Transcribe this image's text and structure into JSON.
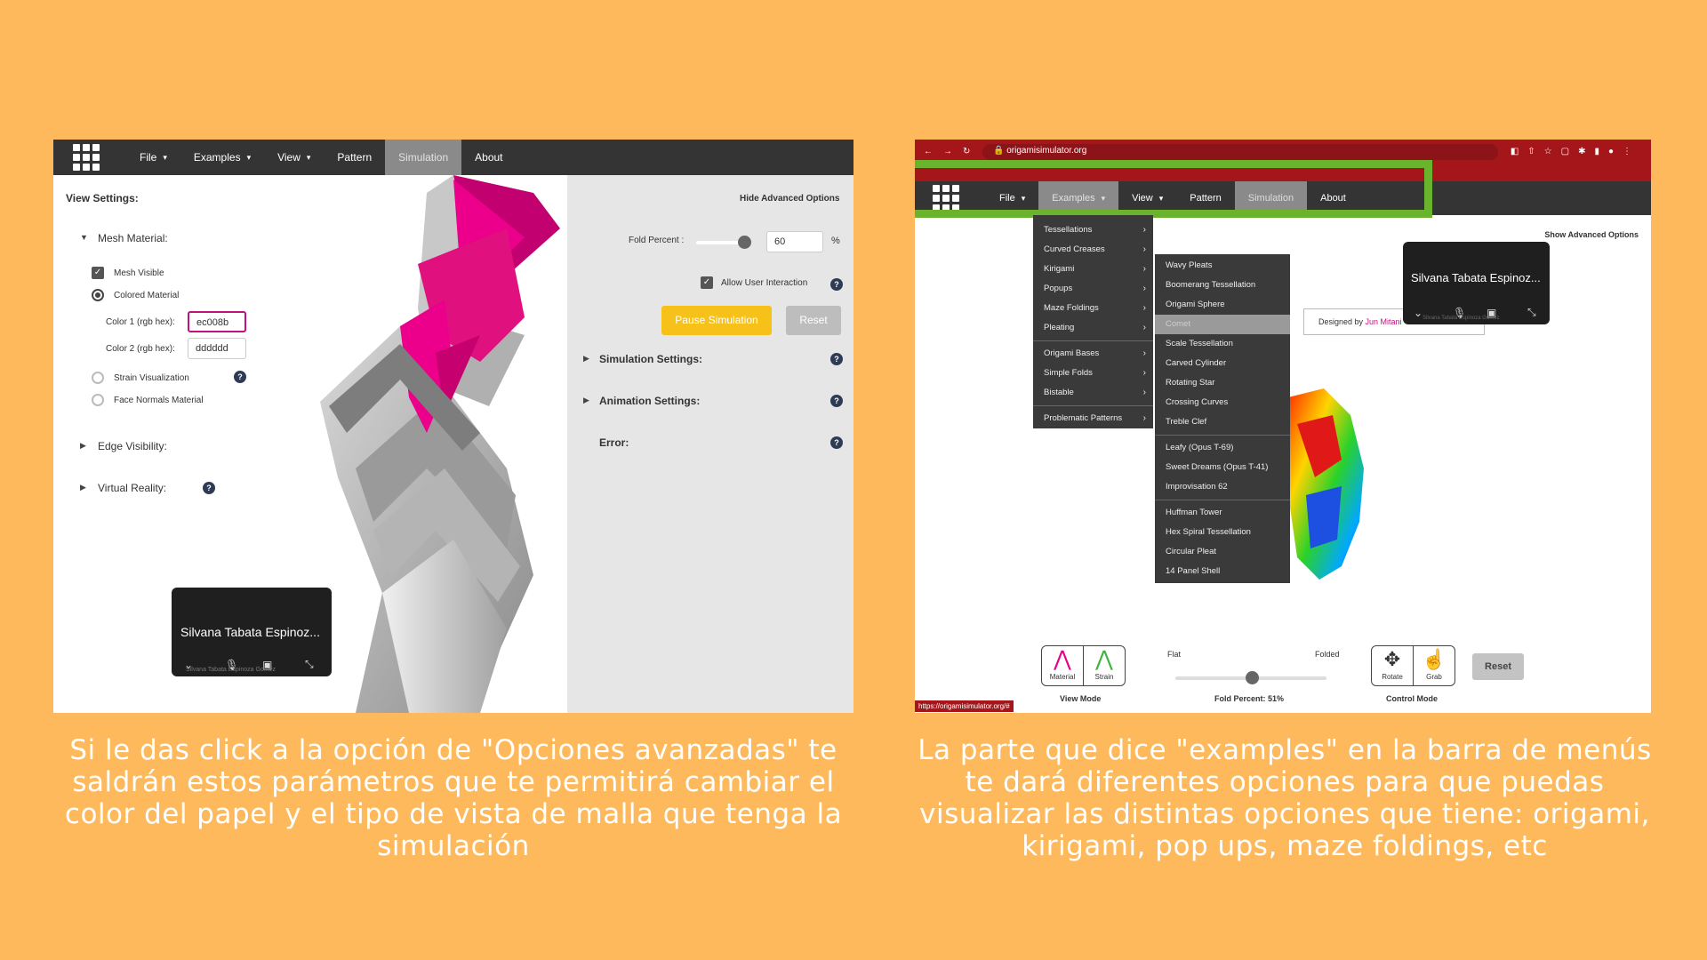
{
  "left_screenshot": {
    "nav": {
      "items": [
        {
          "label": "File",
          "caret": "▾"
        },
        {
          "label": "Examples",
          "caret": "▾"
        },
        {
          "label": "View",
          "caret": "▾"
        },
        {
          "label": "Pattern"
        },
        {
          "label": "Simulation"
        },
        {
          "label": "About"
        }
      ]
    },
    "view_settings": {
      "title": "View Settings:",
      "mesh_material_label": "Mesh Material:",
      "mesh_visible": "Mesh Visible",
      "colored_material": "Colored Material",
      "color1_label": "Color 1 (rgb hex):",
      "color1_value": "ec008b",
      "color2_label": "Color 2 (rgb hex):",
      "color2_value": "dddddd",
      "strain_visualization": "Strain Visualization",
      "face_normals": "Face Normals Material",
      "edge_visibility": "Edge Visibility:",
      "virtual_reality": "Virtual Reality:"
    },
    "advanced": {
      "hide_link": "Hide Advanced Options",
      "fold_percent_label": "Fold Percent :",
      "fold_percent_value": "60",
      "fold_percent_unit": "%",
      "allow_interaction": "Allow User Interaction",
      "pause_button": "Pause Simulation",
      "reset_button": "Reset",
      "simulation_settings": "Simulation Settings:",
      "animation_settings": "Animation Settings:",
      "error": "Error:"
    },
    "video": {
      "name": "Silvana Tabata Espinoz...",
      "subname": "Silvana Tabata Espinoza Gomez"
    }
  },
  "right_screenshot": {
    "browser": {
      "url": "origamisimulator.org"
    },
    "nav": {
      "items": [
        {
          "label": "File",
          "caret": "▾"
        },
        {
          "label": "Examples",
          "caret": "▾"
        },
        {
          "label": "View",
          "caret": "▾"
        },
        {
          "label": "Pattern"
        },
        {
          "label": "Simulation"
        },
        {
          "label": "About"
        }
      ]
    },
    "show_advanced": "Show Advanced Options",
    "examples_menu": [
      "Tessellations",
      "Curved Creases",
      "Kirigami",
      "Popups",
      "Maze Foldings",
      "Pleating",
      "Origami Bases",
      "Simple Folds",
      "Bistable",
      "Problematic Patterns"
    ],
    "submenu": [
      "Wavy Pleats",
      "Boomerang Tessellation",
      "Origami Sphere",
      "Comet",
      "Scale Tessellation",
      "Carved Cylinder",
      "Rotating Star",
      "Crossing Curves",
      "Treble Clef",
      "Leafy (Opus T-69)",
      "Sweet Dreams (Opus T-41)",
      "Improvisation 62",
      "Huffman Tower",
      "Hex Spiral Tessellation",
      "Circular Pleat",
      "14 Panel Shell"
    ],
    "designed_by_prefix": "Designed by ",
    "designed_by_name": "Jun Mitani",
    "video": {
      "name": "Silvana Tabata Espinoz...",
      "subname": "Silvana Tabata Espinoza Gomez"
    },
    "bottom": {
      "material_label": "Material",
      "strain_label": "Strain",
      "view_mode": "View Mode",
      "flat": "Flat",
      "folded": "Folded",
      "fold_percent": "Fold Percent: 51%",
      "rotate_label": "Rotate",
      "grab_label": "Grab",
      "control_mode": "Control Mode",
      "reset": "Reset",
      "status_url": "https://origamisimulator.org/#"
    }
  },
  "captions": {
    "left": "Si le das click a la opción de \"Opciones avanzadas\" te saldrán estos parámetros que te permitirá cambiar el color del papel y el tipo de vista de malla que tenga la simulación",
    "right": "La parte que dice \"examples\" en la barra de menús te dará diferentes opciones para que puedas visualizar las distintas opciones que tiene: origami, kirigami, pop ups, maze foldings, etc"
  },
  "colors": {
    "background": "#fdb95b",
    "magenta": "#ec008b",
    "highlight_green": "#6ab42d",
    "pause_yellow": "#f6c21a"
  }
}
